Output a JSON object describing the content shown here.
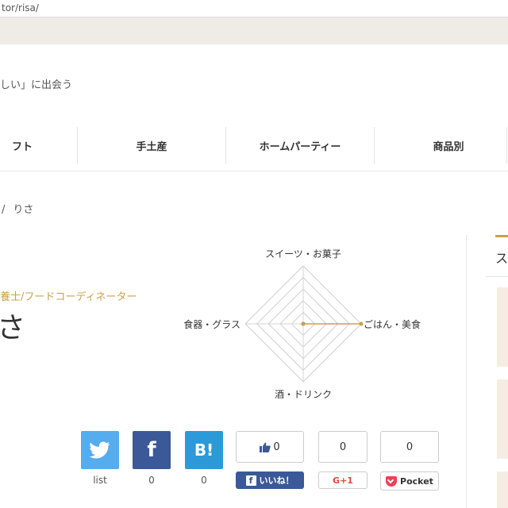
{
  "browser": {
    "url_fragment": "tor/risa/"
  },
  "site": {
    "tagline": "しい」に出会う"
  },
  "nav": {
    "items": [
      "フト",
      "手土産",
      "ホームパーティー",
      "商品別"
    ]
  },
  "breadcrumb": {
    "separator": "/",
    "current": "りさ"
  },
  "profile": {
    "job_title": "養士/フードコーディネーター",
    "name_fragment": "さ"
  },
  "radar": {
    "labels": {
      "top": "スイーツ・お菓子",
      "right": "ごはん・美食",
      "bottom": "酒・ドリンク",
      "left": "食器・グラス"
    },
    "levels": 5,
    "values": {
      "top": 0,
      "right": 1,
      "bottom": 0,
      "left": 0
    },
    "accent_color": "#c8a24a"
  },
  "share": {
    "twitter": {
      "count": "list",
      "icon": "twitter-bird-icon",
      "color": "#55acee"
    },
    "facebook": {
      "label": "f",
      "count": "0",
      "color": "#3b5998"
    },
    "hatena": {
      "label": "B!",
      "count": "0",
      "color": "#2c9ad8"
    },
    "fb_like": {
      "count": "0",
      "button_label": "いいね！"
    },
    "google_plus": {
      "count": "0",
      "label": "G+1"
    },
    "pocket": {
      "count": "0",
      "label": "Pocket"
    }
  },
  "sidebar": {
    "heading_fragment": "ス"
  }
}
